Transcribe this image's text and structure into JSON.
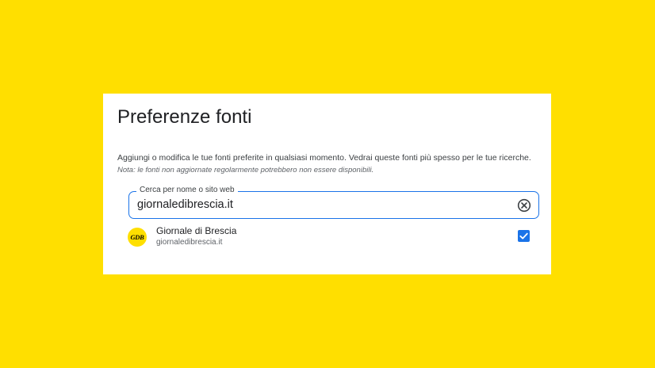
{
  "colors": {
    "background": "#FFDF00",
    "accent": "#1a73e8",
    "card": "#ffffff"
  },
  "dialog": {
    "title": "Preferenze fonti",
    "description": "Aggiungi o modifica le tue fonti preferite in qualsiasi momento. Vedrai queste fonti più spesso per le tue ricerche.",
    "note": "Nota: le fonti non aggiornate regolarmente potrebbero non essere disponibili."
  },
  "search": {
    "label": "Cerca per nome o sito web",
    "value": "giornaledibrescia.it",
    "clear_icon": "clear-circle-icon"
  },
  "results": [
    {
      "logo_text": "GDB",
      "name": "Giornale di Brescia",
      "domain": "giornaledibrescia.it",
      "checked": true,
      "check_icon": "checkbox-checked-icon"
    }
  ]
}
